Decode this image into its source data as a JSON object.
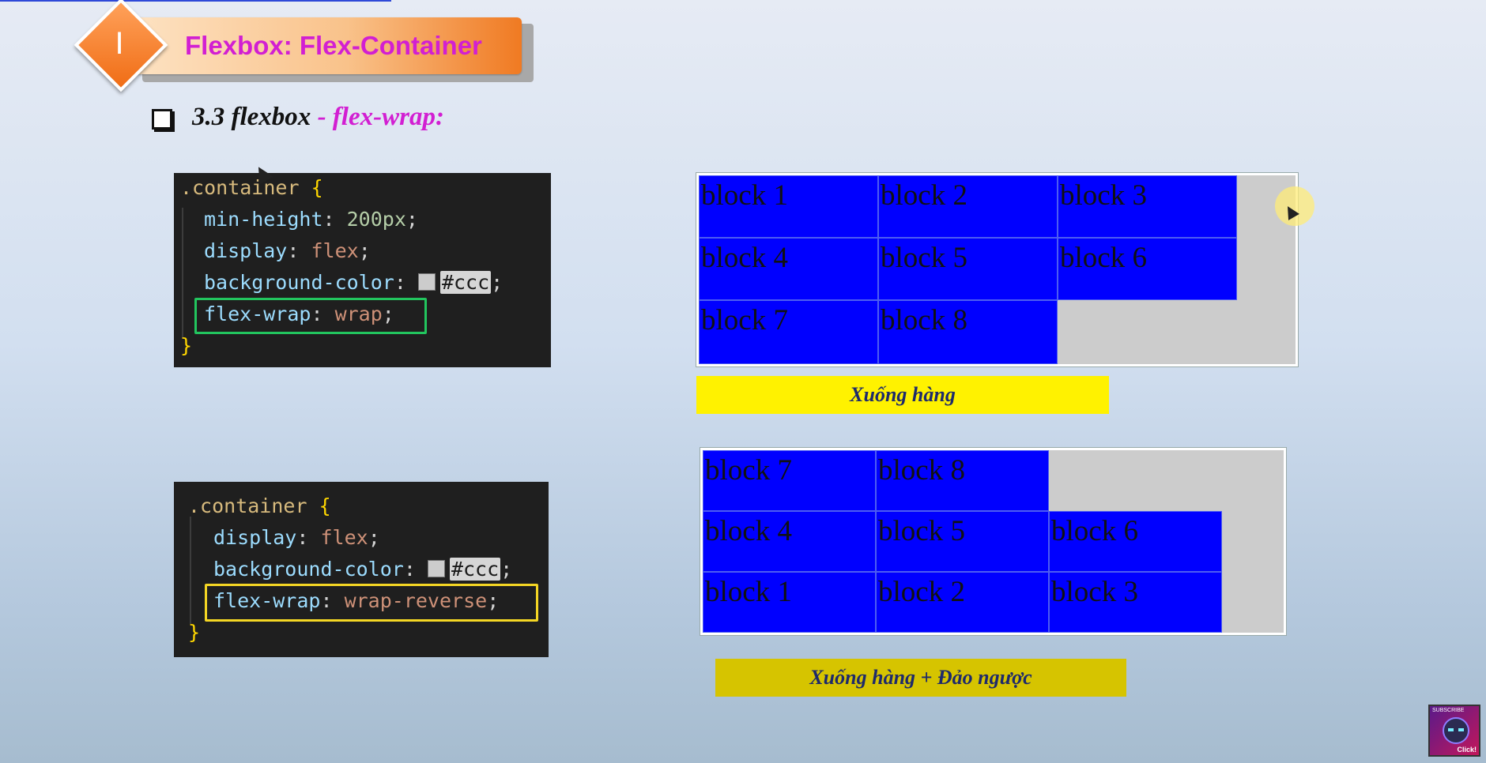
{
  "header": {
    "badge": "I",
    "title": "Flexbox: Flex-Container"
  },
  "subtitle": {
    "part1": "3.3 flexbox",
    "part2": " - flex-wrap:"
  },
  "code1": {
    "selector": ".container",
    "open_brace": "{",
    "close_brace": "}",
    "l1_prop": "min-height",
    "l1_val": "200px",
    "l2_prop": "display",
    "l2_val": "flex",
    "l3_prop": "background-color",
    "l3_val": "#ccc",
    "l4_prop": "flex-wrap",
    "l4_val": "wrap"
  },
  "code2": {
    "selector": ".container",
    "open_brace": "{",
    "close_brace": "}",
    "l1_prop": "display",
    "l1_val": "flex",
    "l2_prop": "background-color",
    "l2_val": "#ccc",
    "l3_prop": "flex-wrap",
    "l3_val": "wrap-reverse"
  },
  "demo_wrap": {
    "blocks": [
      "block 1",
      "block 2",
      "block 3",
      "block 4",
      "block 5",
      "block 6",
      "block 7",
      "block 8"
    ],
    "caption": "Xuống hàng"
  },
  "demo_wrap_reverse": {
    "blocks": [
      "block 1",
      "block 2",
      "block 3",
      "block 4",
      "block 5",
      "block 6",
      "block 7",
      "block 8"
    ],
    "caption": "Xuống hàng + Đảo ngược"
  },
  "thumbnail": {
    "top_text": "SUBSCRIBE",
    "bottom_text": "Click!"
  },
  "colors": {
    "block": "#0000ff",
    "container": "#cccccc",
    "caption1_bg": "#fff200",
    "caption2_bg": "#d6c400",
    "title_accent": "#d21fd2"
  }
}
